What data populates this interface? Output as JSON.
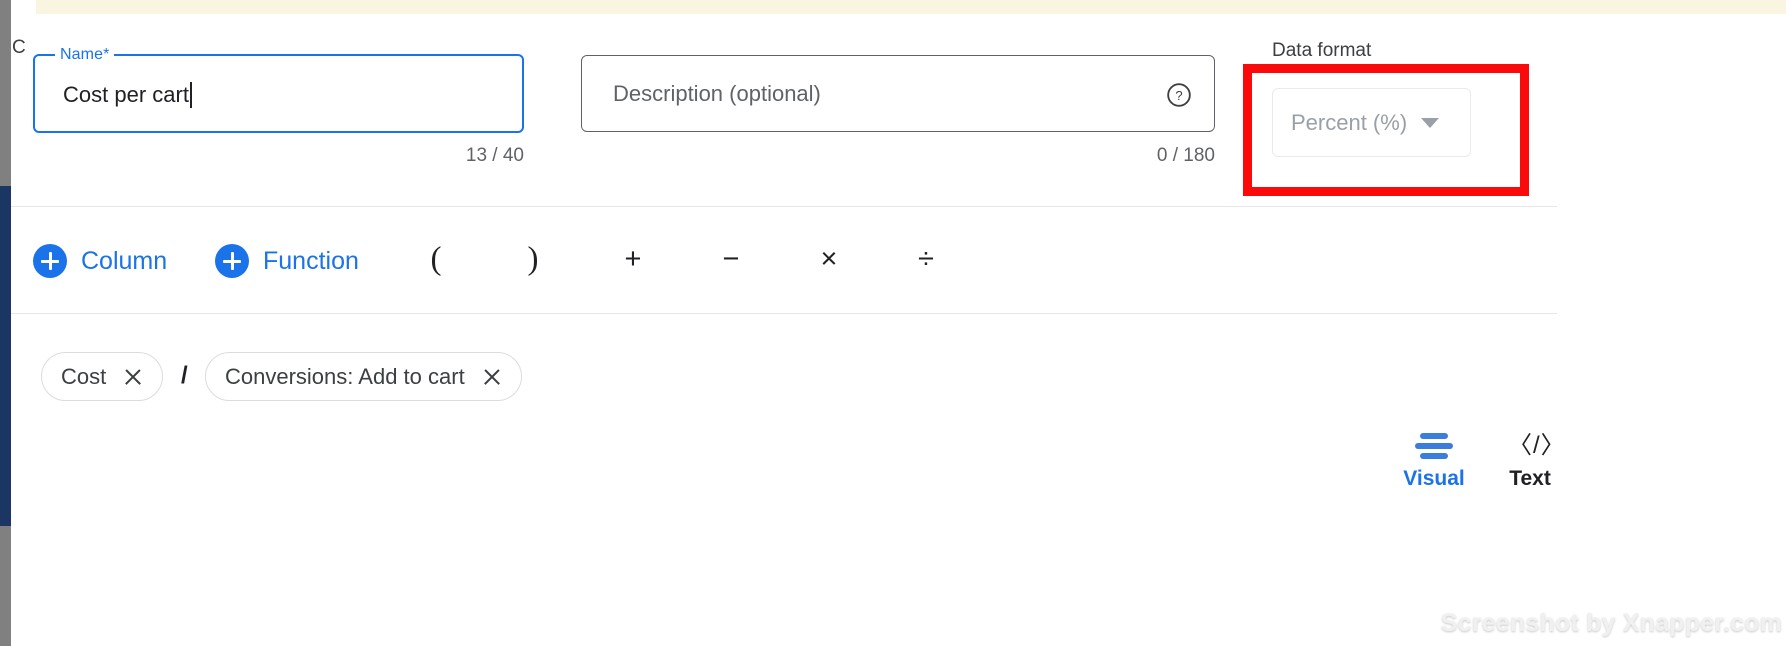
{
  "window": {
    "background_color": "#ffffff",
    "banner_color": "#faf5e0",
    "accent_color": "#1a73e8",
    "highlight_color": "#fa0a0a",
    "clipped_glyph": "C"
  },
  "form": {
    "name": {
      "legend": "Name*",
      "value": "Cost per cart",
      "counter": "13 / 40"
    },
    "description": {
      "placeholder": "Description (optional)",
      "value": "",
      "counter": "0 / 180",
      "help_icon": "help-circle-icon"
    },
    "data_format": {
      "label": "Data format",
      "selected": "Percent (%)",
      "chevron": "chevron-down-icon"
    }
  },
  "toolbar": {
    "column_button": "Column",
    "function_button": "Function",
    "operators": [
      {
        "name": "open-paren",
        "glyph": "("
      },
      {
        "name": "close-paren",
        "glyph": ")"
      },
      {
        "name": "plus",
        "glyph": "+"
      },
      {
        "name": "minus",
        "glyph": "−"
      },
      {
        "name": "multiply",
        "glyph": "×"
      },
      {
        "name": "divide",
        "glyph": "÷"
      }
    ],
    "view_modes": [
      {
        "name": "visual",
        "label": "Visual",
        "icon": "align-lines-icon",
        "active": true
      },
      {
        "name": "text",
        "label": "Text",
        "icon": "code-brackets-icon",
        "active": false
      }
    ],
    "text_icon_glyph": "〈/〉"
  },
  "formula": {
    "chips": [
      {
        "label": "Cost",
        "close": "close-icon"
      },
      {
        "label": "Conversions: Add to cart",
        "close": "close-icon"
      }
    ],
    "separator": "/"
  },
  "watermark": {
    "text": "Screenshot by Xnapper.com"
  }
}
